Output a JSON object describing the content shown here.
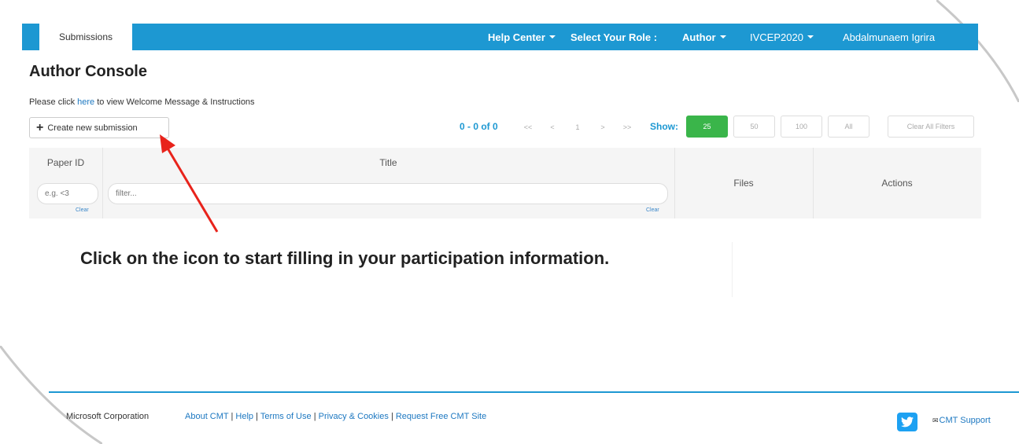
{
  "navbar": {
    "tab_submissions": "Submissions",
    "help_center": "Help Center",
    "select_role_label": "Select Your Role :",
    "role": "Author",
    "conference": "IVCEP2020",
    "user": "Abdalmunaem Igrira"
  },
  "page": {
    "title": "Author Console",
    "welcome_prefix": "Please click ",
    "welcome_link": "here",
    "welcome_suffix": " to view Welcome Message & Instructions"
  },
  "toolbar": {
    "create_label": "Create new submission",
    "range": "0 - 0 of 0",
    "pager": {
      "first": "<<",
      "prev": "<",
      "page": "1",
      "next": ">",
      "last": ">>"
    },
    "show_label": "Show:",
    "show_options": [
      "25",
      "50",
      "100",
      "All"
    ],
    "show_selected": "25",
    "clear_all_filters": "Clear All Filters"
  },
  "table": {
    "headers": {
      "paper_id": "Paper ID",
      "title": "Title",
      "files": "Files",
      "actions": "Actions"
    },
    "paper_id_placeholder": "e.g. <3",
    "title_placeholder": "filter...",
    "clear_label": "Clear"
  },
  "annotation": {
    "instruction": "Click on the icon to start filling in your participation information."
  },
  "footer": {
    "copyright": "Microsoft Corporation",
    "links": [
      "About CMT",
      "Help",
      "Terms of Use",
      "Privacy & Cookies",
      "Request Free CMT Site"
    ],
    "support": "CMT Support"
  },
  "colors": {
    "navbar_blue": "#1d98d2",
    "active_green": "#3ab54a",
    "arrow_red": "#e8231b",
    "link_blue": "#1d78c1"
  },
  "icons": [
    "plus-icon",
    "caret-down-icon",
    "twitter-icon",
    "envelope-icon"
  ]
}
